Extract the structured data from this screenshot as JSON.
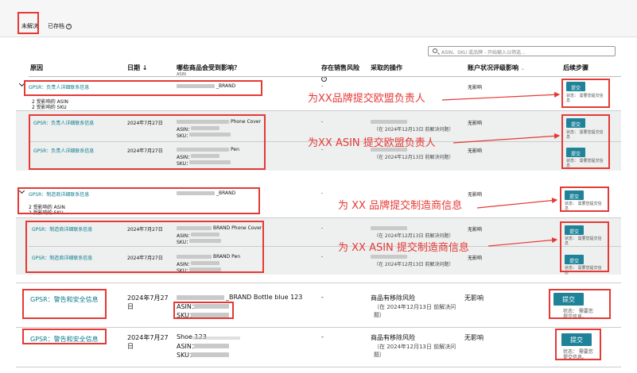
{
  "tabs": {
    "unresolved": "未解决",
    "archived": "已存档"
  },
  "search": {
    "placeholder": "ASIN、SKU 或品牌 - 开始输入以筛选..."
  },
  "columns": {
    "reason": "原因",
    "date": "日期",
    "affected": "哪些商品会受到影响？",
    "affected_sub": "ASIN",
    "risk": "存在销售风险",
    "action": "采取的操作",
    "impact": "账户状况评级影响",
    "next": "后续步骤"
  },
  "groups": {
    "g1": {
      "reason": "GPSR：负责人详细联系信息",
      "brand": "_BRAND",
      "asin_count": "2 受影响的 ASIN",
      "sku_count": "2 受影响的 SKU",
      "risk": "-",
      "impact": "无影响",
      "button": "提交",
      "status": "状态： 需要您提交信息",
      "rows": [
        {
          "reason": "GPSR：负责人详细联系信息",
          "date": "2024年7月27日",
          "product": "Phone Cover",
          "asin": "ASIN：",
          "sku": "SKU：",
          "risk": "-",
          "action": "（在 2024年12月13日 前解决问题）",
          "impact": "无影响",
          "button": "提交",
          "status": "状态： 需要您提交信息"
        },
        {
          "reason": "GPSR：负责人详细联系信息",
          "date": "2024年7月27日",
          "product": "Pen",
          "asin": "ASIN：",
          "sku": "SKU：",
          "risk": "-",
          "action": "（在 2024年12月13日 前解决问题）",
          "impact": "无影响",
          "button": "提交",
          "status": "状态： 需要您提交信息"
        }
      ]
    },
    "g2": {
      "reason": "GPSR：制造商详细联系信息",
      "brand": "_BRAND",
      "asin_count": "2 受影响的 ASIN",
      "sku_count": "2 受影响的 SKU",
      "risk": "-",
      "impact": "无影响",
      "button": "提交",
      "status": "状态： 需要您提交信息",
      "rows": [
        {
          "reason": "GPSR：制造商详细联系信息",
          "date": "2024年7月27日",
          "product": "BRAND Phone Cover",
          "asin": "ASIN：",
          "sku": "SKU：",
          "risk": "-",
          "action": "（在 2024年12月13日 前解决问题）",
          "impact": "无影响",
          "button": "提交",
          "status": "状态： 需要您提交信息"
        },
        {
          "reason": "GPSR：制造商详细联系信息",
          "date": "2024年7月27日",
          "product": "BRAND Pen",
          "asin": "ASIN：",
          "sku": "SKU：",
          "risk": "-",
          "action": "（在 2024年12月13日 前解决问题）",
          "impact": "无影响",
          "button": "提交",
          "status": "状态： 需要您提交信息"
        }
      ]
    },
    "g3": {
      "rows": [
        {
          "reason": "GPSR：警告和安全信息",
          "date_line1": "2024年7月27",
          "date_line2": "日",
          "product": "_BRAND Bottle blue 123",
          "asin": "ASIN：",
          "sku": "SKU：",
          "risk": "-",
          "action_title": "商品有移除风险",
          "action_line1": "（在 2024年12月13日 前解决问",
          "action_line2": "题）",
          "impact": "无影响",
          "button": "提交",
          "status_line1": "状态： 需要您",
          "status_line2": "提交信息。"
        },
        {
          "reason": "GPSR：警告和安全信息",
          "date_line1": "2024年7月27",
          "date_line2": "日",
          "product": "Shoe 123",
          "asin": "ASIN：",
          "sku": "SKU：",
          "risk": "-",
          "action_title": "商品有移除风险",
          "action_line1": "（在 2024年12月13日 前解决问",
          "action_line2": "题）",
          "impact": "无影响",
          "button": "提交",
          "status_line1": "状态： 需要您",
          "status_line2": "提交信息。"
        }
      ]
    }
  },
  "annotations": {
    "a1": "为XX品牌提交欧盟负责人",
    "a2": "为XX ASIN 提交欧盟负责人",
    "a3": "为 XX 品牌提交制造商信息",
    "a4": "为 XX ASIN 提交制造商信息"
  },
  "colors": {
    "accent": "#1e8299",
    "link": "#0a7b8c",
    "annotation": "#e53935"
  }
}
